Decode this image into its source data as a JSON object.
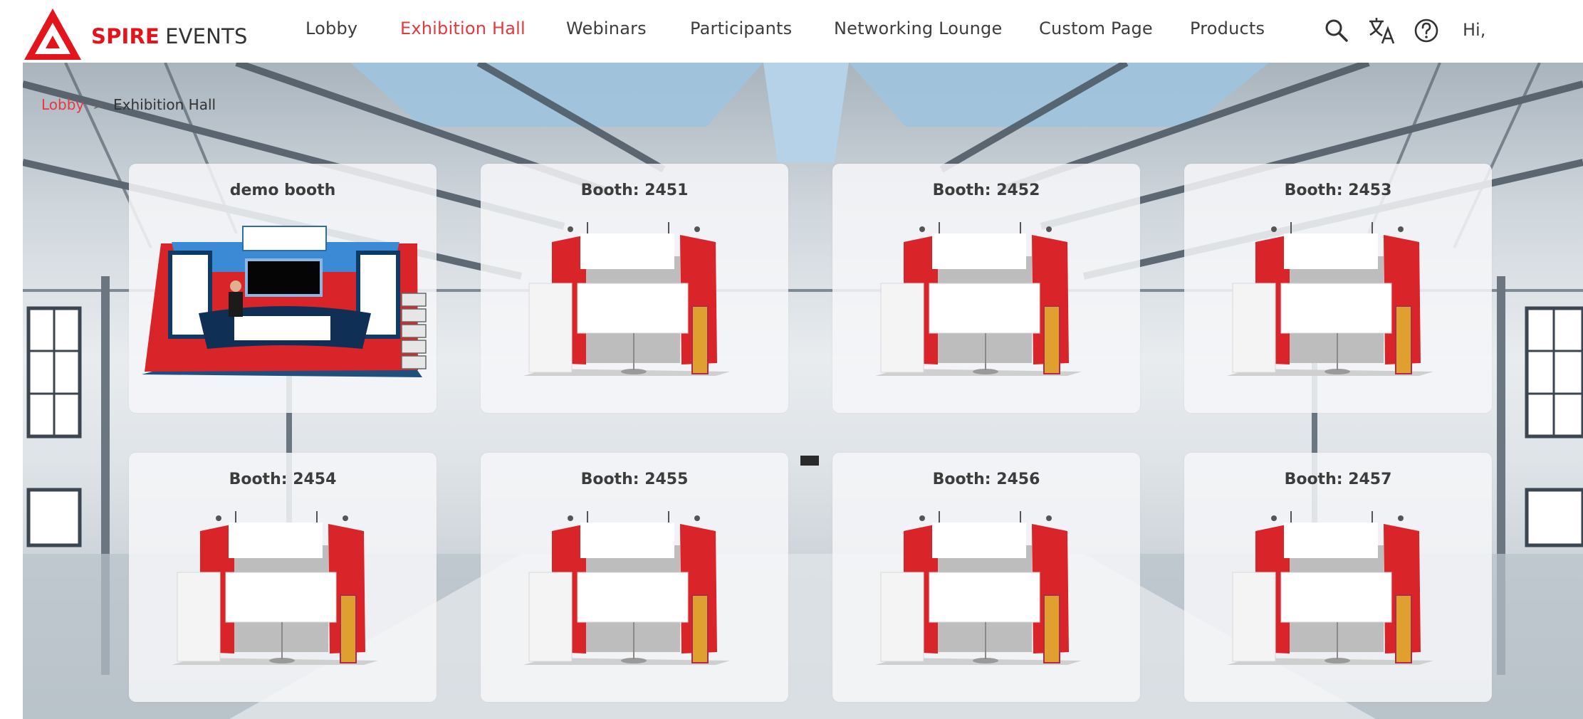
{
  "header": {
    "logo": {
      "brand_primary": "SPIRE",
      "brand_secondary": "EVENTS",
      "brand_color": "#e3141c"
    },
    "nav": [
      {
        "label": "Lobby",
        "active": false
      },
      {
        "label": "Exhibition Hall",
        "active": true
      },
      {
        "label": "Webinars",
        "active": false
      },
      {
        "label": "Participants",
        "active": false
      },
      {
        "label": "Networking Lounge",
        "active": false
      },
      {
        "label": "Custom Page",
        "active": false
      },
      {
        "label": "Products",
        "active": false
      }
    ],
    "icons": [
      "search-icon",
      "translate-icon",
      "help-icon"
    ],
    "greeting": "Hi,"
  },
  "breadcrumb": {
    "root": "Lobby",
    "separator": ">",
    "current": "Exhibition Hall"
  },
  "booths": [
    {
      "title": "demo booth",
      "style": "demo"
    },
    {
      "title": "Booth: 2451",
      "style": "standard"
    },
    {
      "title": "Booth: 2452",
      "style": "standard"
    },
    {
      "title": "Booth: 2453",
      "style": "standard"
    },
    {
      "title": "Booth: 2454",
      "style": "standard"
    },
    {
      "title": "Booth: 2455",
      "style": "standard"
    },
    {
      "title": "Booth: 2456",
      "style": "standard"
    },
    {
      "title": "Booth: 2457",
      "style": "standard"
    }
  ],
  "colors": {
    "accent": "#e5393f",
    "booth_red": "#d9252a",
    "text": "#3d3d3d"
  }
}
